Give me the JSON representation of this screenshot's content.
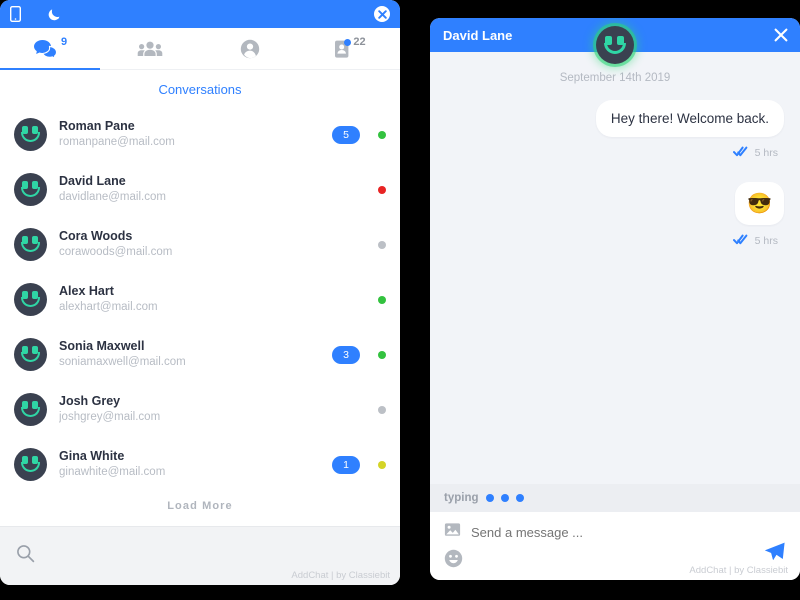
{
  "colors": {
    "accent": "#2f80ff",
    "avatar_bg": "#3a4150",
    "avatar_face": "#2fd6a5",
    "page_bg": "#000000",
    "chat_bg": "#f2f4f8"
  },
  "left_panel": {
    "topbar": {
      "mobile_icon": "mobile-icon",
      "dark_mode_icon": "moon-icon",
      "close_icon": "close-icon"
    },
    "tabs": [
      {
        "icon": "chats-icon",
        "count": "9",
        "active": true
      },
      {
        "icon": "groups-icon",
        "count": "",
        "active": false
      },
      {
        "icon": "person-icon",
        "count": "",
        "active": false
      },
      {
        "icon": "contacts-icon",
        "count": "22",
        "active": false
      }
    ],
    "section_title": "Conversations",
    "conversations": [
      {
        "name": "Roman Pane",
        "email": "romanpane@mail.com",
        "badge": "5",
        "status": "#33c23f"
      },
      {
        "name": "David Lane",
        "email": "davidlane@mail.com",
        "badge": "",
        "status": "#e82424"
      },
      {
        "name": "Cora Woods",
        "email": "corawoods@mail.com",
        "badge": "",
        "status": "#bcc0c6"
      },
      {
        "name": "Alex Hart",
        "email": "alexhart@mail.com",
        "badge": "",
        "status": "#33c23f"
      },
      {
        "name": "Sonia Maxwell",
        "email": "soniamaxwell@mail.com",
        "badge": "3",
        "status": "#33c23f"
      },
      {
        "name": "Josh Grey",
        "email": "joshgrey@mail.com",
        "badge": "",
        "status": "#bcc0c6"
      },
      {
        "name": "Gina White",
        "email": "ginawhite@mail.com",
        "badge": "1",
        "status": "#d4d427"
      }
    ],
    "load_more_label": "Load More",
    "search_icon": "search-icon",
    "credit": "AddChat | by Classiebit"
  },
  "right_panel": {
    "title": "David Lane",
    "close_icon": "close-icon",
    "avatar_icon": "smiley-avatar",
    "chat_date": "September 14th 2019",
    "messages": [
      {
        "text": "Hey there! Welcome back.",
        "time": "5 hrs",
        "read": true,
        "is_emoji": false
      },
      {
        "text": "😎",
        "time": "5 hrs",
        "read": true,
        "is_emoji": true
      }
    ],
    "typing": {
      "label": "typing",
      "dots": 3
    },
    "compose": {
      "image_icon": "image-icon",
      "placeholder": "Send a message ...",
      "emoji_icon": "emoji-icon",
      "send_icon": "send-icon"
    },
    "credit": "AddChat | by Classiebit"
  }
}
